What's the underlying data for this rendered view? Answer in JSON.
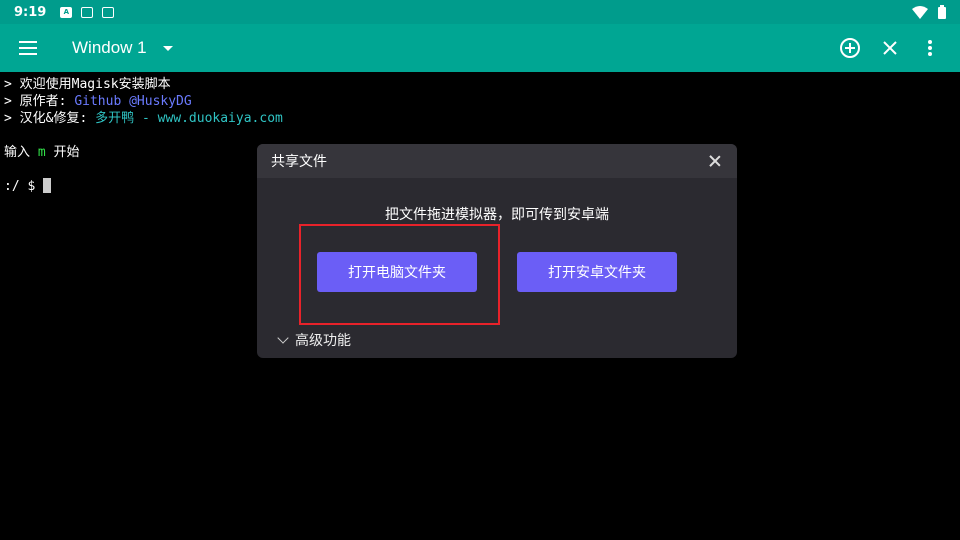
{
  "statusbar": {
    "time": "9:19",
    "icons": [
      "a-notification-icon",
      "keyboard-icon",
      "terminal-notification-icon"
    ],
    "right_icons": [
      "wifi-icon",
      "battery-icon"
    ]
  },
  "appbar": {
    "title": "Window 1",
    "color": "#00a693"
  },
  "terminal": {
    "line1": "> 欢迎使用Magisk安装脚本",
    "line2_prefix": "> 原作者: ",
    "line2_link": "Github @HuskyDG",
    "line3_prefix": "> 汉化&修复: ",
    "line3_link": "多开鸭 - www.duokaiya.com",
    "line5_prefix": "输入 ",
    "line5_key": "m",
    "line5_suffix": " 开始",
    "prompt": ":/ $ "
  },
  "dialog": {
    "title": "共享文件",
    "hint": "把文件拖进模拟器，即可传到安卓端",
    "open_pc_label": "打开电脑文件夹",
    "open_android_label": "打开安卓文件夹",
    "advanced_label": "高级功能",
    "accent": "#6b5ef6",
    "highlight_color": "#e8222a"
  }
}
